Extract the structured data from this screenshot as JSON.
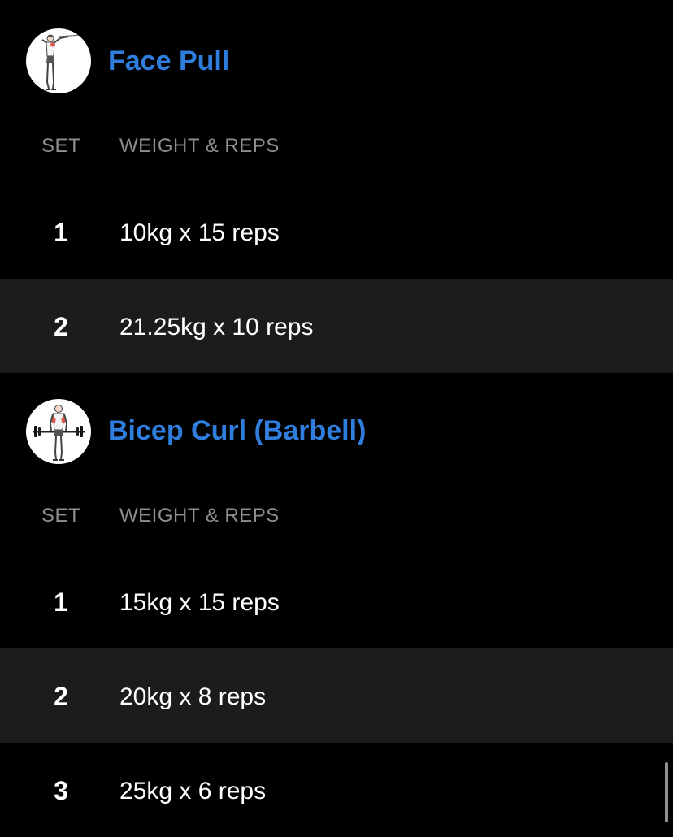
{
  "colors": {
    "background": "#000000",
    "alt_row": "#1c1c1e",
    "accent": "#2f7ddc",
    "header_text": "#8e8e93",
    "text": "#ffffff"
  },
  "exercises": [
    {
      "name": "Face Pull",
      "icon": "face-pull-exercise-icon",
      "columns": {
        "set": "SET",
        "weight_reps": "WEIGHT & REPS"
      },
      "sets": [
        {
          "set": "1",
          "value": "10kg x 15 reps"
        },
        {
          "set": "2",
          "value": "21.25kg x 10 reps"
        }
      ]
    },
    {
      "name": "Bicep Curl (Barbell)",
      "icon": "bicep-curl-exercise-icon",
      "columns": {
        "set": "SET",
        "weight_reps": "WEIGHT & REPS"
      },
      "sets": [
        {
          "set": "1",
          "value": "15kg x 15 reps"
        },
        {
          "set": "2",
          "value": "20kg x 8 reps"
        },
        {
          "set": "3",
          "value": "25kg x 6 reps"
        }
      ]
    }
  ]
}
